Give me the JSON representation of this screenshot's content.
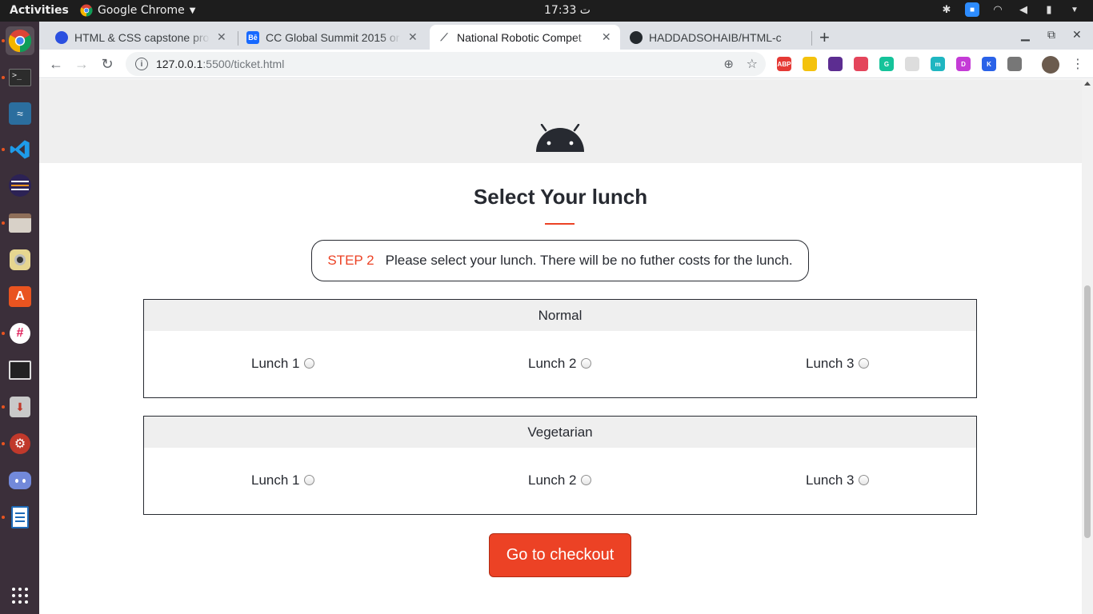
{
  "topbar": {
    "activities": "Activities",
    "app_name": "Google Chrome",
    "clock": "17:33 ت"
  },
  "tabs": [
    {
      "title": "HTML & CSS capstone pro",
      "favicon": "owl-icon",
      "color": "#2b50e0"
    },
    {
      "title": "CC Global Summit 2015 or",
      "favicon": "behance-icon",
      "label": "Bē",
      "color": "#1769ff"
    },
    {
      "title": "National Robotic Compet",
      "favicon": "robot-arm-icon",
      "active": true
    },
    {
      "title": "HADDADSOHAIB/HTML-c",
      "favicon": "github-icon"
    }
  ],
  "omnibox": {
    "host": "127.0.0.1",
    "path": ":5500/ticket.html"
  },
  "extensions": [
    {
      "name": "adblock-icon",
      "label": "ABP",
      "color": "#e53935"
    },
    {
      "name": "notes-icon",
      "label": "",
      "color": "#f4c20d"
    },
    {
      "name": "block-icon",
      "label": "",
      "color": "#5c2d91"
    },
    {
      "name": "lastpass-icon",
      "label": "",
      "color": "#e4455b"
    },
    {
      "name": "grammarly-icon",
      "label": "G",
      "color": "#15c39a"
    },
    {
      "name": "blank-extension-icon",
      "label": "",
      "color": "#dddddd"
    },
    {
      "name": "m-extension-icon",
      "label": "m",
      "color": "#1fb6c1"
    },
    {
      "name": "d-extension-icon",
      "label": "D",
      "color": "#c43bd6"
    },
    {
      "name": "k-extension-icon",
      "label": "K",
      "color": "#2a62e8"
    },
    {
      "name": "bug-extension-icon",
      "label": "",
      "color": "#777777"
    }
  ],
  "page": {
    "title": "Select Your lunch",
    "step_label": "STEP 2",
    "step_text": "Please select your lunch. There will be no futher costs for the lunch.",
    "groups": [
      {
        "name": "Normal",
        "options": [
          "Lunch 1",
          "Lunch 2",
          "Lunch 3"
        ]
      },
      {
        "name": "Vegetarian",
        "options": [
          "Lunch 1",
          "Lunch 2",
          "Lunch 3"
        ]
      }
    ],
    "checkout_label": "Go to checkout"
  },
  "colors": {
    "accent": "#ec4225",
    "text": "#272a31",
    "band": "#efefef"
  }
}
